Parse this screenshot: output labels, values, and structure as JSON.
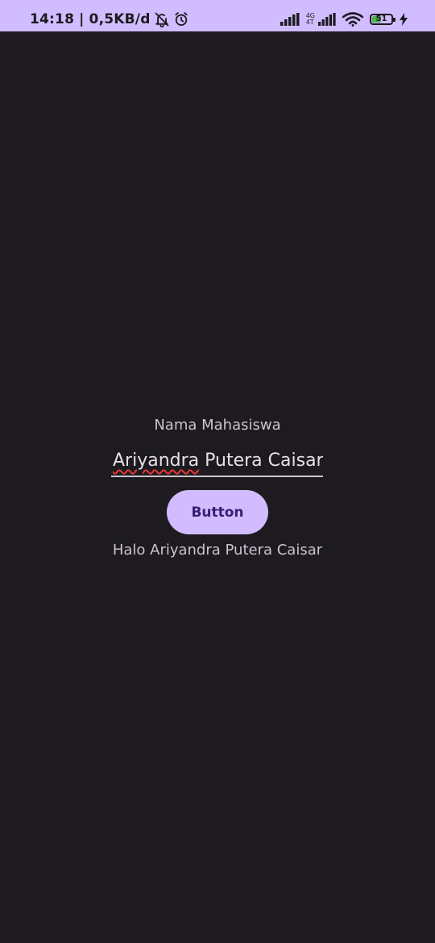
{
  "status_bar": {
    "time": "14:18",
    "separator": "|",
    "speed": "0,5KB/d",
    "network_type_top": "4G",
    "network_type_bottom": "4T",
    "battery_percent": "51",
    "battery_level": 51,
    "icons": [
      "bell-off-icon",
      "alarm-icon",
      "signal-icon",
      "signal-icon",
      "wifi-icon",
      "battery-icon",
      "charging-icon"
    ],
    "background": "#d0bcff"
  },
  "form": {
    "label": "Nama Mahasiswa",
    "input_first_word": "Ariyandra",
    "input_rest": " Putera Caisar",
    "button_label": "Button",
    "greeting": "Halo Ariyandra Putera Caisar"
  },
  "colors": {
    "background": "#1d1b20",
    "accent": "#d0bcff",
    "on_accent": "#381e72",
    "text_secondary": "#cac4d0",
    "spellcheck": "#e53935"
  }
}
